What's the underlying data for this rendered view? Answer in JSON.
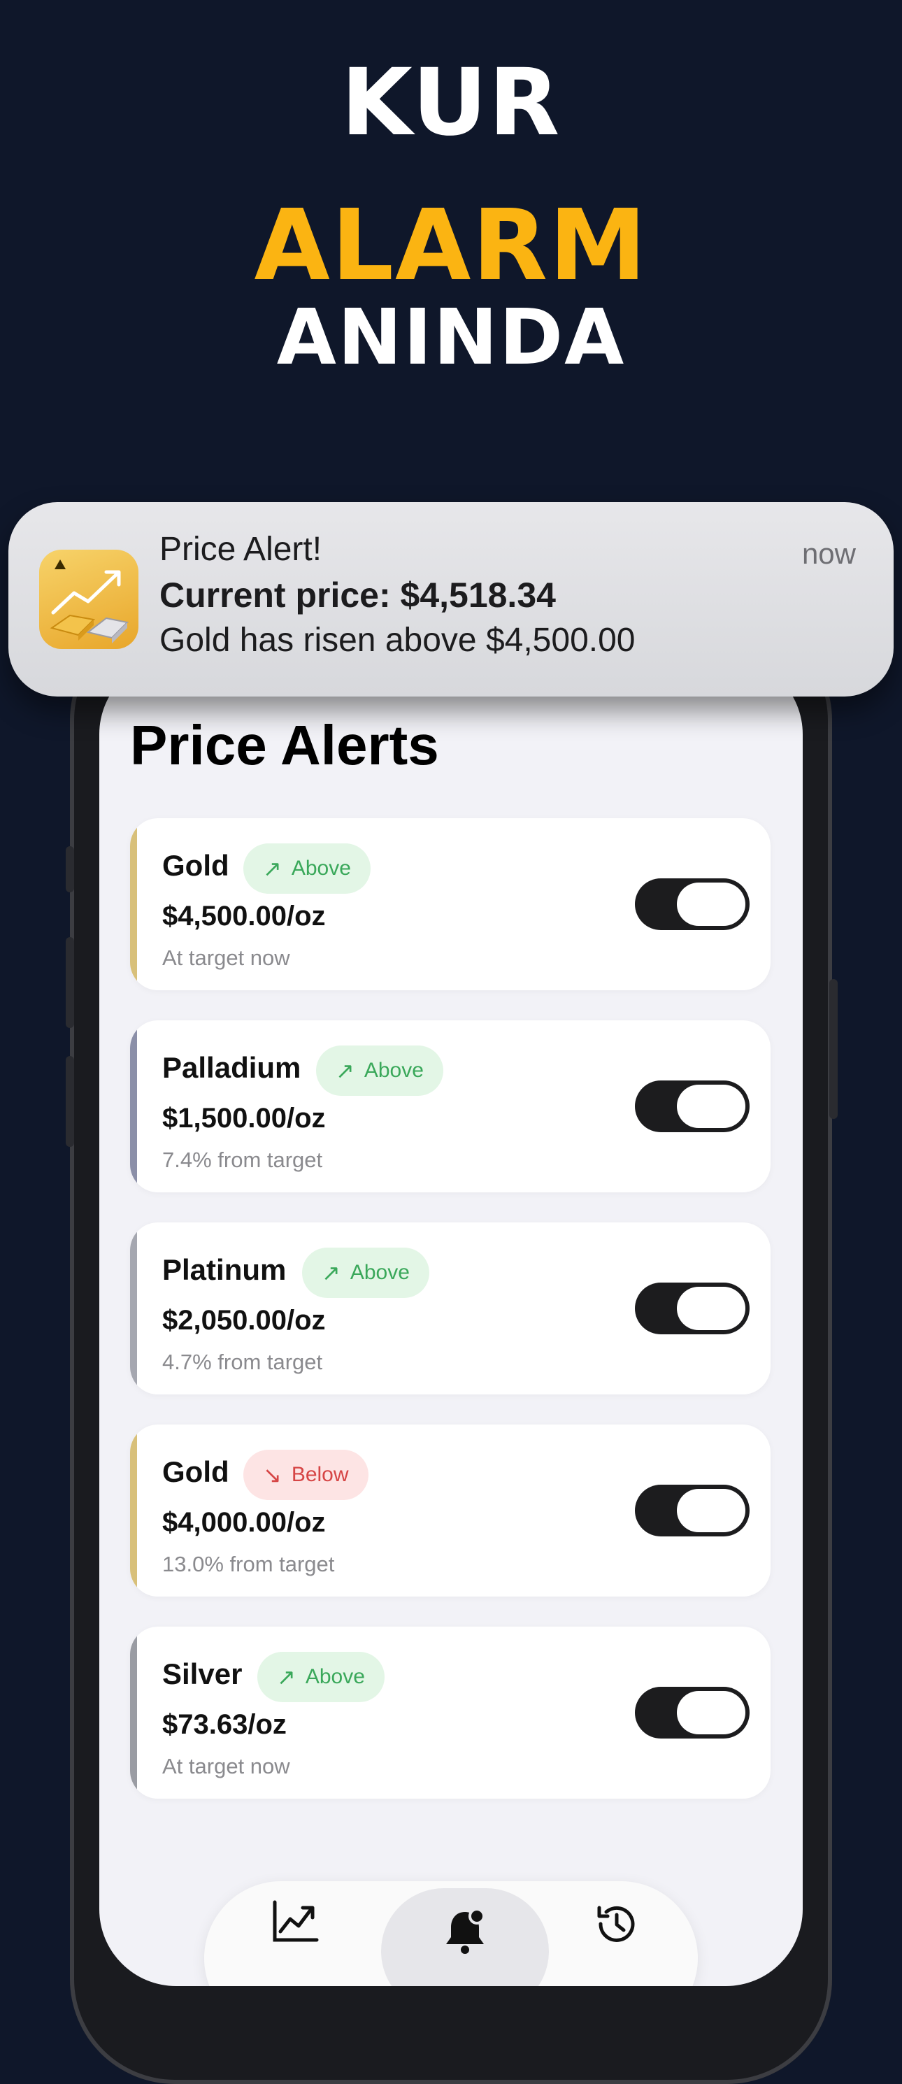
{
  "headline": {
    "line1": "KUR",
    "line2": "ALARM",
    "line3": "ANINDA"
  },
  "notification": {
    "title": "Price Alert!",
    "line1": "Current price: $4,518.34",
    "line2": "Gold has risen above $4,500.00",
    "time": "now",
    "app_icon": "gold-bars-chart-icon"
  },
  "page": {
    "title": "Price Alerts"
  },
  "alerts": [
    {
      "metal": "Gold",
      "direction": "Above",
      "arrow": "↗",
      "price": "$4,500.00/oz",
      "status": "At target now",
      "accent": "#d8c07a",
      "enabled": true
    },
    {
      "metal": "Palladium",
      "direction": "Above",
      "arrow": "↗",
      "price": "$1,500.00/oz",
      "status": "7.4% from target",
      "accent": "#8b8fa8",
      "enabled": true
    },
    {
      "metal": "Platinum",
      "direction": "Above",
      "arrow": "↗",
      "price": "$2,050.00/oz",
      "status": "4.7% from target",
      "accent": "#a5a7b0",
      "enabled": true
    },
    {
      "metal": "Gold",
      "direction": "Below",
      "arrow": "↘",
      "price": "$4,000.00/oz",
      "status": "13.0% from target",
      "accent": "#d8c07a",
      "enabled": true
    },
    {
      "metal": "Silver",
      "direction": "Above",
      "arrow": "↗",
      "price": "$73.63/oz",
      "status": "At target now",
      "accent": "#9a9ca3",
      "enabled": true
    }
  ],
  "tabs": [
    {
      "icon": "chart-line-icon",
      "active": false
    },
    {
      "icon": "bell-icon",
      "active": true
    },
    {
      "icon": "history-icon",
      "active": false
    }
  ],
  "colors": {
    "background": "#0f172a",
    "accent": "#fbb412",
    "toggle_on": "#1c1c1e"
  }
}
